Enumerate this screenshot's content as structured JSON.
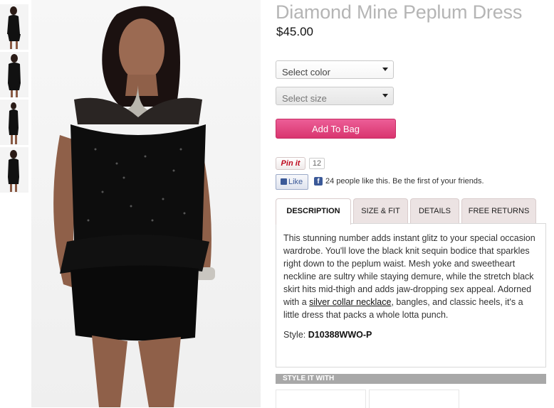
{
  "product": {
    "title": "Diamond Mine Peplum Dress",
    "price": "$45.00"
  },
  "selects": {
    "color_placeholder": "Select color",
    "size_placeholder": "Select size"
  },
  "add_to_bag_label": "Add To Bag",
  "social": {
    "pin_label": "Pin it",
    "pin_count": "12",
    "like_label": "Like",
    "like_text": "24 people like this. Be the first of your friends."
  },
  "tabs": [
    {
      "label": "DESCRIPTION",
      "active": true
    },
    {
      "label": "SIZE & FIT",
      "active": false
    },
    {
      "label": "DETAILS",
      "active": false
    },
    {
      "label": "FREE RETURNS",
      "active": false
    }
  ],
  "description": {
    "text_before_link": "This stunning number adds instant glitz to your special occasion wardrobe. You'll love the black knit sequin bodice that sparkles right down to the peplum waist. Mesh yoke and sweetheart neckline are sultry while staying demure, while the stretch black skirt hits mid-thigh and adds jaw-dropping sex appeal. Adorned with a ",
    "link_text": "silver collar necklace",
    "text_after_link": ", bangles, and classic heels, it's a little dress that packs a whole lotta punch.",
    "style_label": "Style:",
    "style_code": "D10388WWO-P"
  },
  "style_it_with_label": "STYLE IT WITH",
  "colors": {
    "accent_pink": "#e0447f",
    "title_gray": "#b5b5b5",
    "facebook_blue": "#3b5998"
  }
}
